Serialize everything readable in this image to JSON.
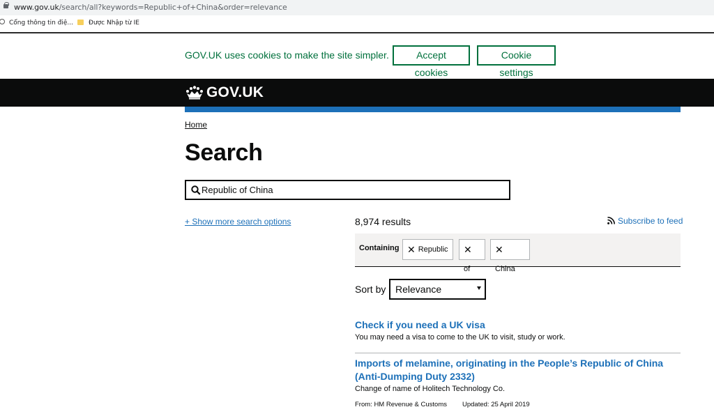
{
  "browser": {
    "url_host": "www.gov.uk",
    "url_path": "/search/all?keywords=Republic+of+China&order=relevance",
    "bookmarks": [
      {
        "label": "Cổng thông tin điệ..."
      },
      {
        "label": "Được Nhập từ IE"
      }
    ]
  },
  "cookie_banner": {
    "message": "GOV.UK uses cookies to make the site simpler.",
    "accept_label": "Accept cookies",
    "settings_label": "Cookie settings"
  },
  "header": {
    "logo_text": "GOV.UK",
    "logo_icon": "crown-icon"
  },
  "breadcrumb": {
    "home": "Home"
  },
  "page": {
    "title": "Search"
  },
  "search": {
    "value": "Republic of China"
  },
  "filters": {
    "show_more_label": "+ Show more search options",
    "results_count": "8,974 results",
    "subscribe_label": "Subscribe to feed",
    "containing_label": "Containing",
    "chips": [
      "Republic",
      "of",
      "China"
    ]
  },
  "sort": {
    "label": "Sort by",
    "selected": "Relevance"
  },
  "results": [
    {
      "title": "Check if you need a UK visa",
      "description": "You may need a visa to come to the UK to visit, study or work."
    },
    {
      "title": "Imports of melamine, originating in the People’s Republic of China (Anti-Dumping Duty 2332)",
      "description": "Change of name of Holitech Technology Co.",
      "from": "From: HM Revenue & Customs",
      "updated": "Updated: 25 April 2019"
    }
  ],
  "colors": {
    "link": "#1d70b8",
    "cookie_green": "#00703c",
    "header_bg": "#0b0c0c"
  }
}
